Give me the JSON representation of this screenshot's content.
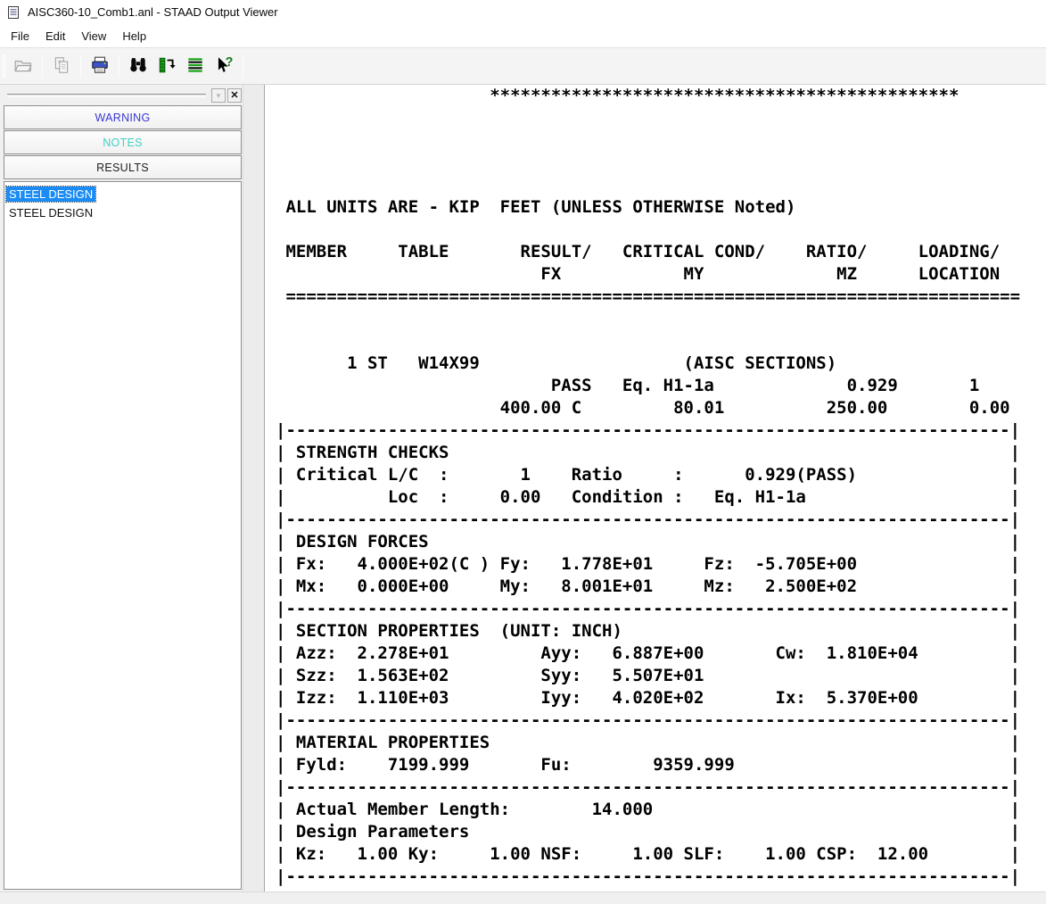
{
  "window": {
    "title": "AISC360-10_Comb1.anl - STAAD Output Viewer"
  },
  "menu": {
    "items": [
      "File",
      "Edit",
      "View",
      "Help"
    ]
  },
  "toolbar": {
    "icons": [
      "open-folder-icon",
      "copy-icon",
      "print-icon",
      "find-icon",
      "goto-icon",
      "report-list-icon",
      "context-help-icon"
    ],
    "disabled_icons": [
      "open-folder-icon",
      "copy-icon"
    ]
  },
  "sidebar": {
    "section_buttons": [
      {
        "label": "WARNING",
        "color": "#3a36cf"
      },
      {
        "label": "NOTES",
        "color": "#3ed1c2"
      },
      {
        "label": "RESULTS",
        "color": "#1f1f1f"
      }
    ],
    "tree_items": [
      {
        "label": "STEEL DESIGN",
        "selected": true
      },
      {
        "label": "STEEL DESIGN",
        "selected": false
      }
    ],
    "selection_color": "#1b8cf5"
  },
  "output": {
    "lines": [
      "                     **********************************************",
      "",
      "",
      "",
      "",
      " ALL UNITS ARE - KIP  FEET (UNLESS OTHERWISE Noted)",
      "",
      " MEMBER     TABLE       RESULT/   CRITICAL COND/    RATIO/     LOADING/",
      "                          FX            MY             MZ      LOCATION",
      " ========================================================================",
      "",
      "",
      "       1 ST   W14X99                    (AISC SECTIONS)",
      "                           PASS   Eq. H1-1a             0.929       1",
      "                      400.00 C         80.01          250.00        0.00",
      "|-----------------------------------------------------------------------|",
      "| STRENGTH CHECKS                                                       |",
      "| Critical L/C  :       1    Ratio     :      0.929(PASS)               |",
      "|          Loc  :     0.00   Condition :   Eq. H1-1a                    |",
      "|-----------------------------------------------------------------------|",
      "| DESIGN FORCES                                                         |",
      "| Fx:   4.000E+02(C ) Fy:   1.778E+01     Fz:  -5.705E+00               |",
      "| Mx:   0.000E+00     My:   8.001E+01     Mz:   2.500E+02               |",
      "|-----------------------------------------------------------------------|",
      "| SECTION PROPERTIES  (UNIT: INCH)                                      |",
      "| Azz:  2.278E+01         Ayy:   6.887E+00       Cw:  1.810E+04         |",
      "| Szz:  1.563E+02         Syy:   5.507E+01                              |",
      "| Izz:  1.110E+03         Iyy:   4.020E+02       Ix:  5.370E+00         |",
      "|-----------------------------------------------------------------------|",
      "| MATERIAL PROPERTIES                                                   |",
      "| Fyld:    7199.999       Fu:        9359.999                           |",
      "|-----------------------------------------------------------------------|",
      "| Actual Member Length:        14.000                                   |",
      "| Design Parameters                                                     |",
      "| Kz:   1.00 Ky:     1.00 NSF:     1.00 SLF:    1.00 CSP:  12.00        |",
      "|-----------------------------------------------------------------------|"
    ]
  }
}
